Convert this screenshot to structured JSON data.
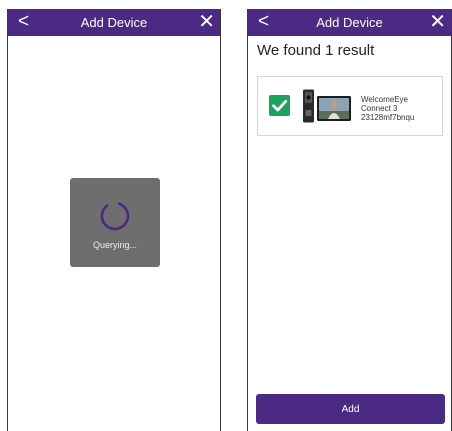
{
  "colors": {
    "header_bg": "#4a2a82",
    "loading_box_bg": "#6e6e6e",
    "checkbox_green": "#1ba35c",
    "add_button_bg": "#4a2a82"
  },
  "left_screen": {
    "header": {
      "back_icon": "chevron-left-icon",
      "back_glyph": "<",
      "title": "Add Device",
      "close_icon": "close-icon",
      "close_glyph": "✕"
    },
    "loading": {
      "spinner_icon": "spinner-icon",
      "text": "Querying..."
    }
  },
  "right_screen": {
    "header": {
      "back_icon": "chevron-left-icon",
      "back_glyph": "<",
      "title": "Add Device",
      "close_icon": "close-icon",
      "close_glyph": "✕"
    },
    "results_title": "We found 1 result",
    "device": {
      "checked": true,
      "checkbox_icon": "checkmark-icon",
      "image_icon": "video-doorbell-kit-icon",
      "name_lines": [
        "WelcomeEye",
        "Connect 3",
        "23128mf7bnqu"
      ]
    },
    "add_button_label": "Add"
  }
}
